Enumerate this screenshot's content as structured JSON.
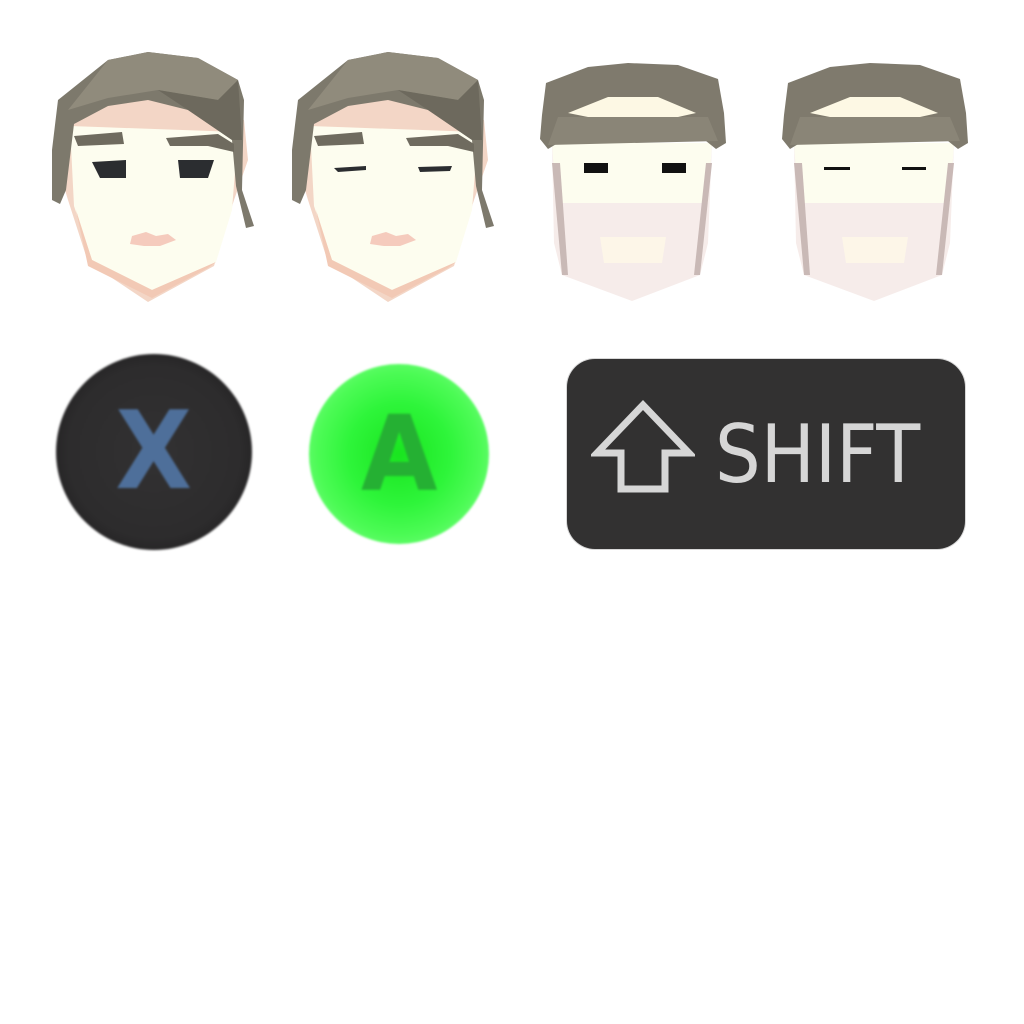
{
  "portraits": [
    {
      "id": "female-eyes-open",
      "icon": "female-face-eyes-open-icon"
    },
    {
      "id": "female-eyes-closed",
      "icon": "female-face-eyes-closed-icon"
    },
    {
      "id": "male-eyes-open",
      "icon": "male-face-eyes-open-icon"
    },
    {
      "id": "male-eyes-closed",
      "icon": "male-face-eyes-closed-icon"
    }
  ],
  "buttons": {
    "x": {
      "label": "X",
      "color": "#4e6f9a",
      "bg": "#2d2c2d"
    },
    "a": {
      "label": "A",
      "color": "#25b033",
      "bg": "#2ef53a"
    }
  },
  "shift_key": {
    "label": "SHIFT",
    "icon": "shift-arrow-icon",
    "bg": "#323131",
    "text_color": "#d6d6d6"
  }
}
